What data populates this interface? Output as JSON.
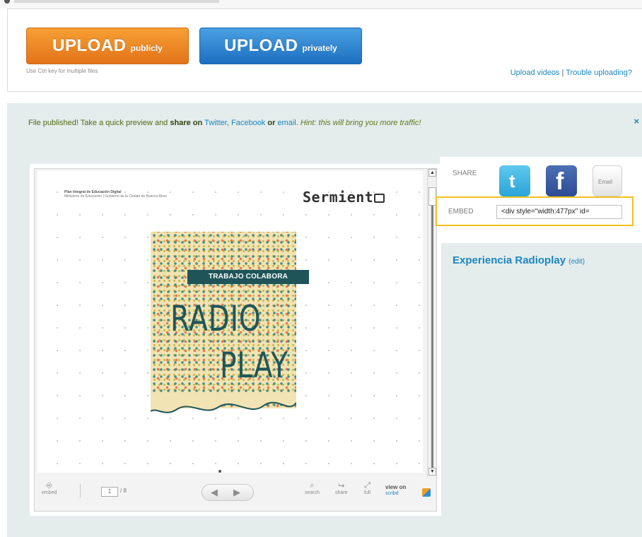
{
  "upload": {
    "public_big": "UPLOAD",
    "public_small": "publicly",
    "private_big": "UPLOAD",
    "private_small": "privately",
    "ctrl_hint": "Use Ctrl key for multiple files",
    "link_videos": "Upload videos",
    "link_separator": "|",
    "link_trouble": "Trouble uploading?"
  },
  "notice": {
    "prefix": "File published! Take a quick preview and ",
    "share_on": "share on",
    "twitter": "Twitter",
    "comma": ",",
    "facebook": "Facebook",
    "or": "or",
    "email": "email",
    "dot": ".",
    "hint": "Hint: this will bring you more traffic!",
    "close": "×"
  },
  "viewer": {
    "header_line1": "Plan Integral de Educación Digital",
    "header_line2": "Ministerio de Educación | Gobierno de la Ciudad de Buenos Aires",
    "logo_text": "Sermient",
    "banner": "TRABAJO COLABORA",
    "cover_word1": "RADIO",
    "cover_word2": "PLAY",
    "scroll_up": "▲",
    "scroll_down": "▼",
    "embed_label": "embed",
    "page_current": "1",
    "page_total": "/ 8",
    "prev": "◀",
    "next": "▶",
    "search_label": "search",
    "share_label": "share",
    "full_label": "full",
    "view_on_line1": "view on",
    "view_on_brand": "scribd"
  },
  "sidebar": {
    "share_label": "SHARE",
    "twitter_glyph": "t",
    "facebook_glyph": "f",
    "email_label": "Email",
    "embed_label": "EMBED",
    "embed_value": "<div style=\"width:477px\" id=",
    "doc_title": "Experiencia Radioplay",
    "edit": "(edit)"
  },
  "colors": {
    "orange": "#e3731b",
    "blue": "#1c6fc0",
    "link": "#1a87c0",
    "highlight": "#f3c01c",
    "panel_bg": "#e4ecec"
  }
}
